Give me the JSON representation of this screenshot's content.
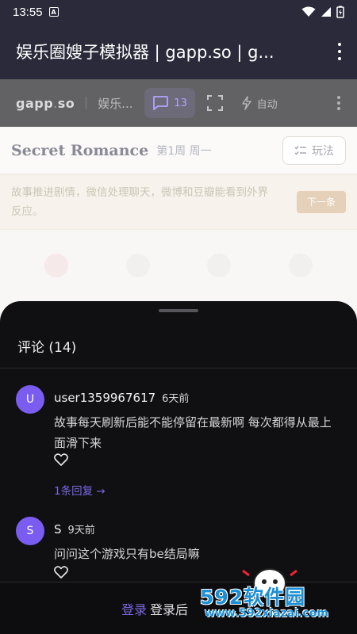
{
  "status_bar": {
    "time": "13:55",
    "a_icon": "A"
  },
  "app_bar": {
    "title": "娱乐圈嫂子模拟器 | gapp.so | g..."
  },
  "web_bar": {
    "brand_name": "gapp",
    "brand_dot": ".",
    "brand_tld": "so",
    "game_short": "娱乐...",
    "chat_count": "13",
    "auto_label": "自动"
  },
  "game": {
    "title": "Secret Romance",
    "week": "第1周 周一",
    "rules_label": "玩法",
    "notice": "故事推进剧情，微信处理聊天，微博和豆瓣能看到外界反应。",
    "next_label": "下一条"
  },
  "comments_sheet": {
    "title": "评论 (14)",
    "comments": [
      {
        "avatar": "U",
        "user": "user1359967617",
        "time": "6天前",
        "body": "故事每天刷新后能不能停留在最新啊 每次都得从最上面滑下来",
        "reply_link": "1条回复 →"
      },
      {
        "avatar": "S",
        "user": "S",
        "time": "9天前",
        "body": "问问这个游戏只有be结局嘛"
      }
    ],
    "footer": {
      "login": "登录",
      "login_hint": "登录后"
    }
  },
  "watermark": {
    "main": "592软件园",
    "url": "www.592xiazai.com"
  },
  "colors": {
    "accent": "#7b5cf0",
    "link": "#7a67e6",
    "sheet_bg": "#101012",
    "appbar_bg": "#2b2a3a"
  }
}
